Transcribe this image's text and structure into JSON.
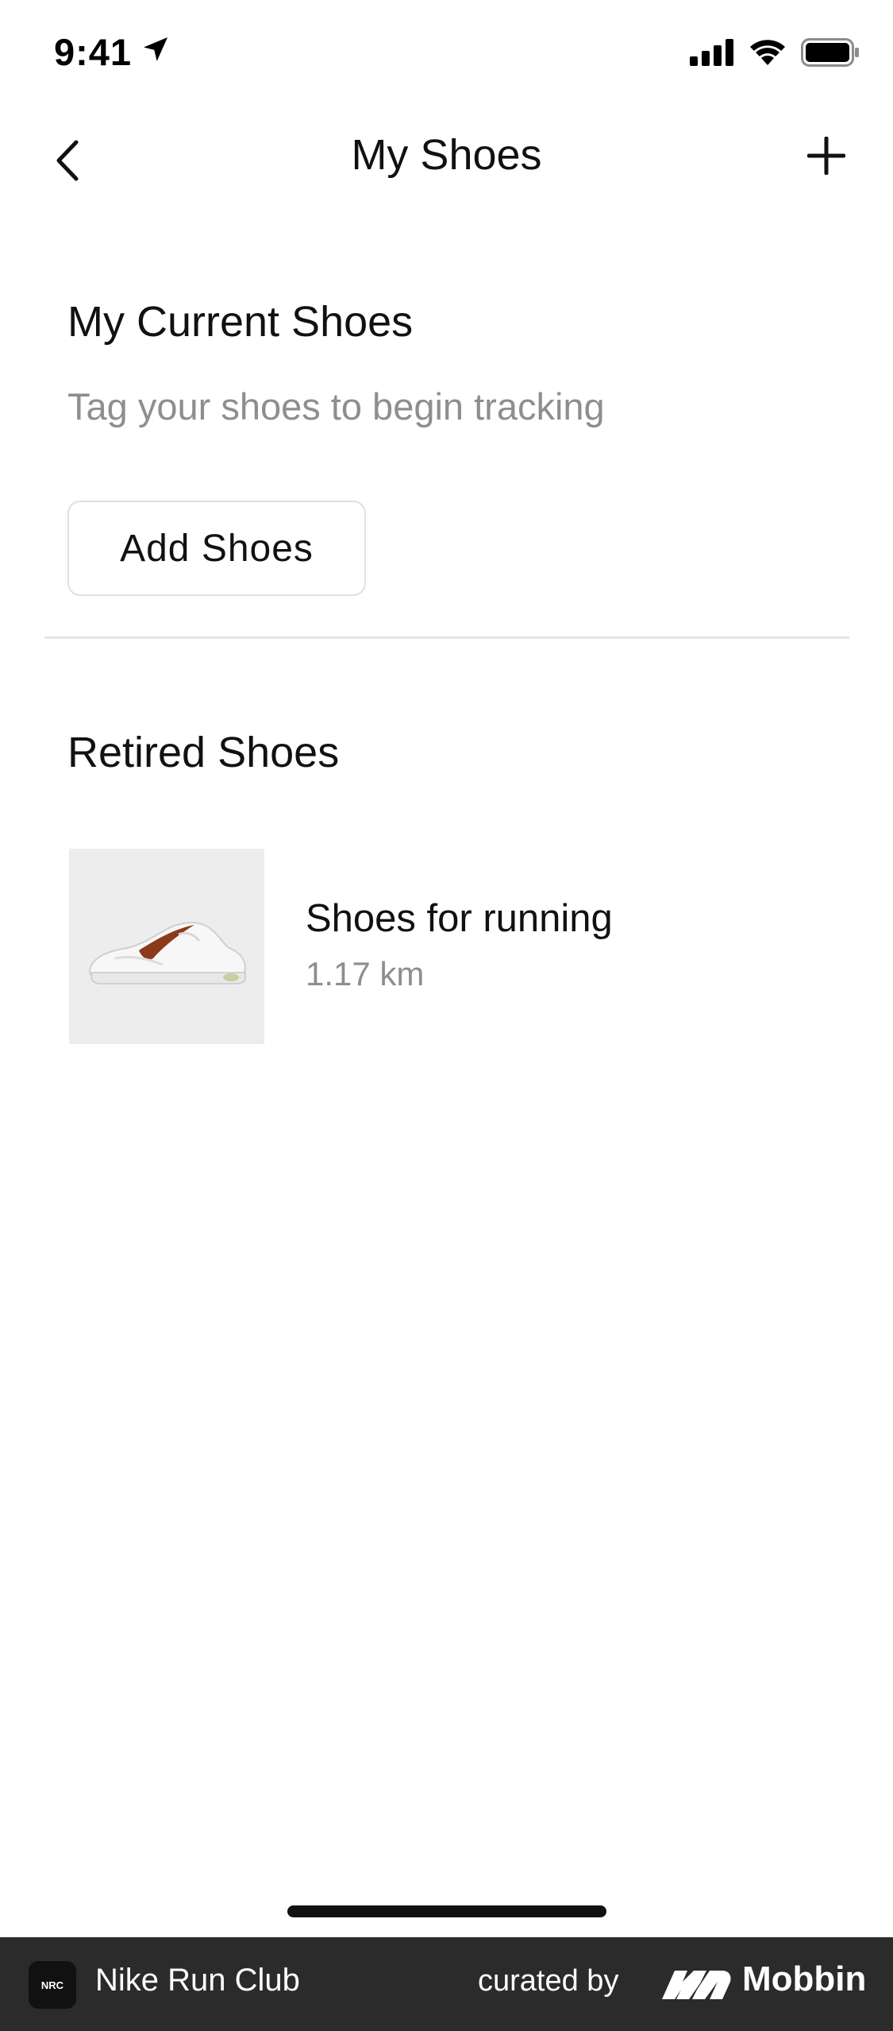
{
  "status_bar": {
    "time": "9:41",
    "icons": [
      "location-arrow-icon",
      "cellular-signal-icon",
      "wifi-icon",
      "battery-icon"
    ]
  },
  "nav": {
    "title": "My Shoes",
    "back_icon": "chevron-left-icon",
    "add_icon": "plus-icon"
  },
  "current_section": {
    "title": "My Current Shoes",
    "subtitle": "Tag your shoes to begin tracking",
    "add_button_label": "Add Shoes"
  },
  "retired_section": {
    "title": "Retired Shoes",
    "items": [
      {
        "name": "Shoes for running",
        "distance": "1.17 km",
        "image_icon": "sneaker-image"
      }
    ]
  },
  "footer": {
    "app_icon_text": "NRC",
    "app_name": "Nike Run Club",
    "curated_label": "curated by",
    "brand_name": "Mobbin"
  },
  "colors": {
    "background": "#ffffff",
    "text_primary": "#111111",
    "text_secondary": "#8e8e8e",
    "divider": "#e5e5e5",
    "footer_bg": "#2b2b2b",
    "swoosh": "#8b3a1a"
  }
}
